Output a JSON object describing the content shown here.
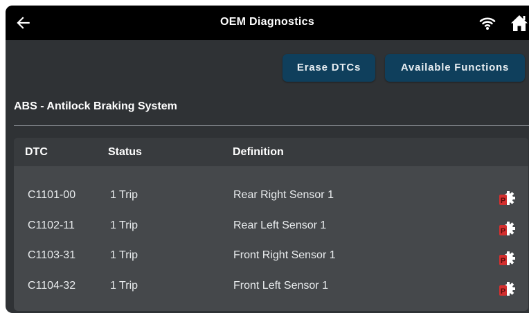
{
  "header": {
    "title": "OEM Diagnostics",
    "back_icon": "back-arrow-icon",
    "wifi_icon": "wifi-icon",
    "home_icon": "home-icon"
  },
  "actions": {
    "erase_label": "Erase DTCs",
    "functions_label": "Available Functions"
  },
  "system": {
    "title": "ABS - Antilock Braking System"
  },
  "table": {
    "columns": {
      "dtc": "DTC",
      "status": "Status",
      "definition": "Definition"
    },
    "rows": [
      {
        "dtc": "C1101-00",
        "status": "1 Trip",
        "definition": "Rear Right Sensor 1",
        "icon": "freeze-frame-icon"
      },
      {
        "dtc": "C1102-11",
        "status": "1 Trip",
        "definition": "Rear Left Sensor 1",
        "icon": "freeze-frame-icon"
      },
      {
        "dtc": "C1103-31",
        "status": "1 Trip",
        "definition": "Front Right Sensor 1",
        "icon": "freeze-frame-icon"
      },
      {
        "dtc": "C1104-32",
        "status": "1 Trip",
        "definition": "Front Left Sensor 1",
        "icon": "freeze-frame-icon"
      }
    ]
  },
  "colors": {
    "header_bg": "#000000",
    "screen_bg": "#2f3235",
    "button_bg": "#0f3f5c",
    "table_bg": "#45484b",
    "table_header_bg": "#383b3e",
    "icon_red": "#d32f2f"
  }
}
